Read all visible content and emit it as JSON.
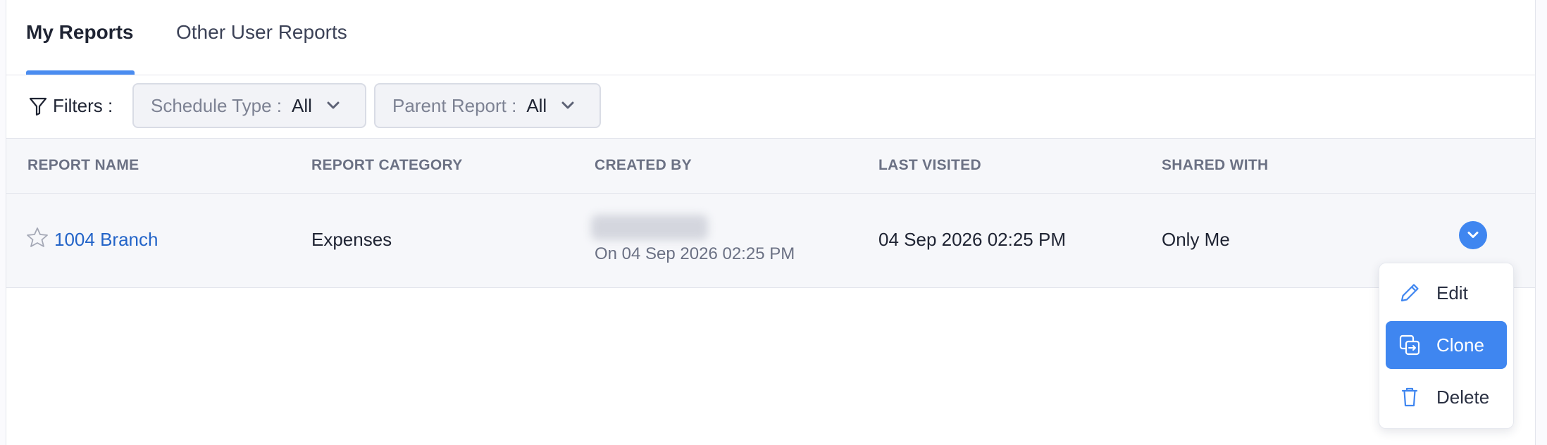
{
  "tabs": {
    "my_reports": "My Reports",
    "other_user_reports": "Other User Reports"
  },
  "filters": {
    "label": "Filters :",
    "schedule_type": {
      "label": "Schedule Type :",
      "value": "All"
    },
    "parent_report": {
      "label": "Parent Report :",
      "value": "All"
    }
  },
  "table": {
    "headers": {
      "report_name": "REPORT NAME",
      "report_category": "REPORT CATEGORY",
      "created_by": "CREATED BY",
      "last_visited": "LAST VISITED",
      "shared_with": "SHARED WITH"
    },
    "rows": [
      {
        "report_name": "1004 Branch",
        "report_category": "Expenses",
        "created_on": "On 04 Sep 2026 02:25 PM",
        "last_visited": "04 Sep 2026 02:25 PM",
        "shared_with": "Only Me"
      }
    ]
  },
  "row_menu": {
    "edit": "Edit",
    "clone": "Clone",
    "delete": "Delete",
    "active_item": "clone"
  },
  "colors": {
    "accent": "#3f86f0",
    "link": "#2364c8",
    "header_text": "#6b7184"
  },
  "icons": {
    "filter": "funnel-icon",
    "dropdown": "chevron-down-icon",
    "favorite": "star-outline-icon",
    "edit": "pencil-icon",
    "clone": "copy-icon",
    "delete": "trash-icon"
  }
}
